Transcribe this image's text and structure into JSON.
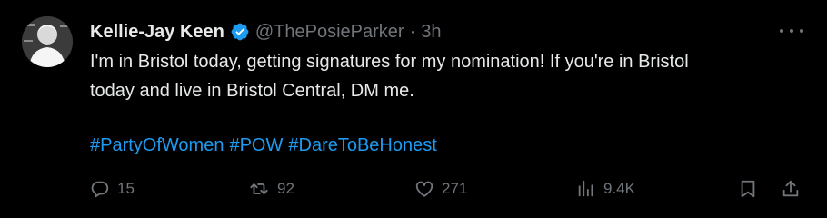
{
  "author": {
    "name": "Kellie-Jay Keen",
    "handle": "@ThePosieParker",
    "separator": "·",
    "time": "3h",
    "verified_color": "#1d9bf0"
  },
  "tweet": {
    "lines": [
      "I'm in Bristol today, getting signatures for my nomination! If you're in Bristol",
      "today and live in Bristol Central, DM me."
    ],
    "hashtags": [
      "#PartyOfWomen",
      "#POW",
      "#DareToBeHonest"
    ]
  },
  "actions": {
    "replies": "15",
    "retweets": "92",
    "likes": "271",
    "views": "9.4K"
  },
  "icons": {
    "reply": "reply-icon",
    "retweet": "retweet-icon",
    "like": "heart-icon",
    "views": "views-icon",
    "bookmark": "bookmark-icon",
    "share": "share-icon",
    "more": "more-icon",
    "verified": "verified-badge-icon"
  },
  "colors": {
    "background": "#000000",
    "text": "#e7e9ea",
    "muted": "#71767b",
    "link": "#1d9bf0"
  }
}
